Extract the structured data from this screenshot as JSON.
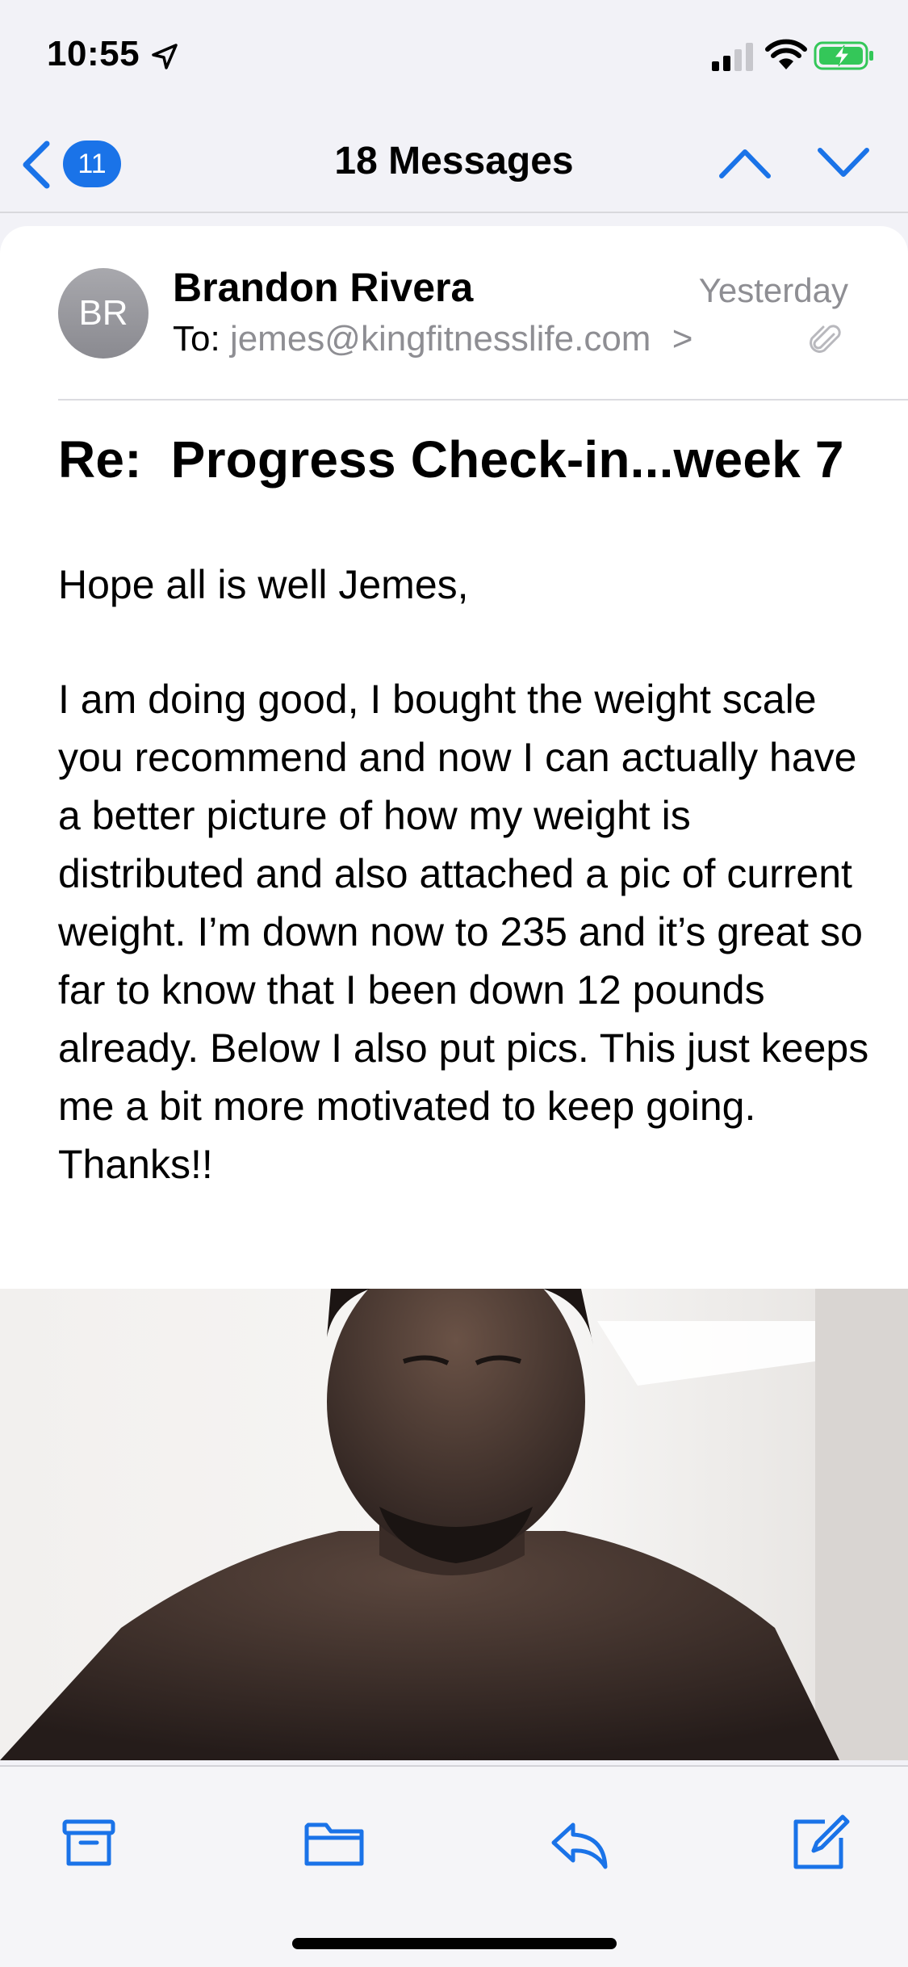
{
  "status_bar": {
    "time": "10:55",
    "icons": [
      "location-arrow-icon",
      "cellular-signal-icon",
      "wifi-icon",
      "battery-charging-icon"
    ],
    "battery_color": "#34c759"
  },
  "nav": {
    "back_badge": "11",
    "title": "18 Messages",
    "accent_color": "#1a73e8"
  },
  "message": {
    "avatar_initials": "BR",
    "sender": "Brandon Rivera",
    "date": "Yesterday",
    "to_label": "To:",
    "to_address": "jemes@kingfitnesslife.com",
    "to_chevron": ">",
    "subject": "Re:  Progress Check-in...week 7",
    "greeting": "Hope all is well Jemes,",
    "body": "I am doing good, I bought the weight scale you recommend and now I can actually have a better picture of how my weight is distributed and also attached a pic of current weight. I’m down now to 235 and it’s great so far to know that I been down 12 pounds already. Below I also put pics. This just keeps me a bit more motivated to keep going. Thanks!!"
  },
  "toolbar": {
    "buttons": [
      "archive-icon",
      "folder-icon",
      "reply-icon",
      "compose-icon"
    ]
  }
}
